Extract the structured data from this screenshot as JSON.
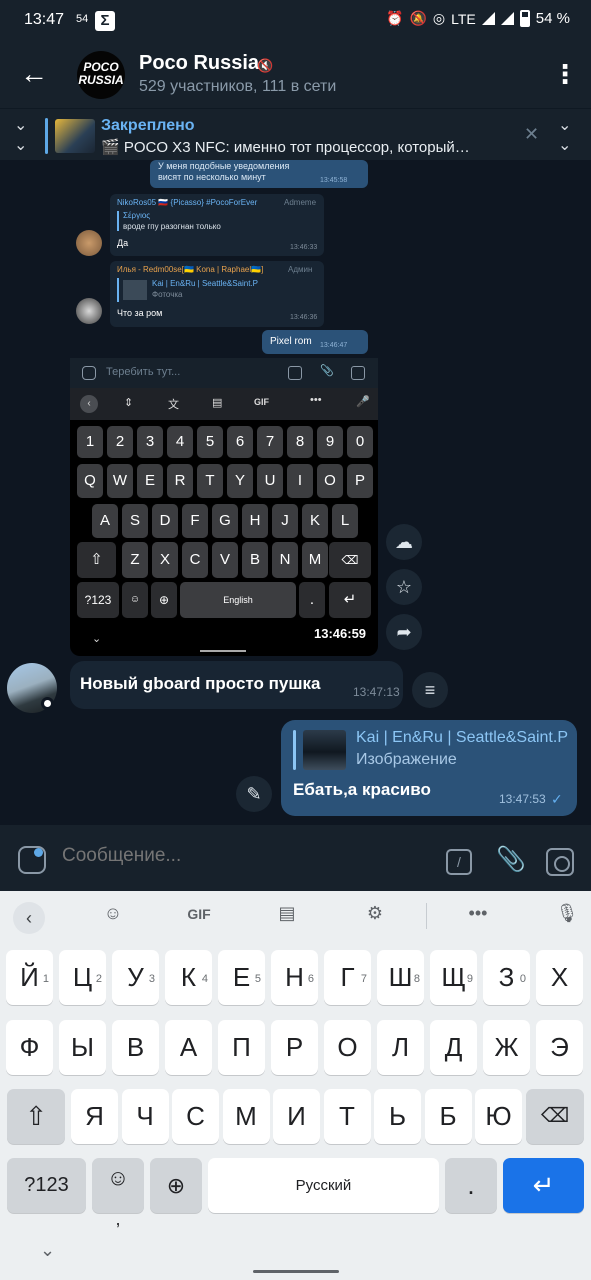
{
  "status": {
    "time": "13:47",
    "notif": "54",
    "network": "LTE",
    "battery": "54 %"
  },
  "header": {
    "avatar_lines": [
      "POCO",
      "RUSSIA"
    ],
    "title": "Poco Russia",
    "subtitle": "529 участников, 111 в сети"
  },
  "pinned": {
    "title": "Закреплено",
    "text": "🎬 POCO X3 NFC: именно тот процессор, который…"
  },
  "inner_screenshot": {
    "msg_top": {
      "text": "У меня подобные уведомления висят по несколько минут",
      "time": "13:45:58"
    },
    "msg_niko": {
      "sender": "NikoRos05 🇷🇺 {Picasso} #PocoForEver",
      "role": "Admeme",
      "reply_name": "Σέργιος",
      "reply_text": "вроде гпу разогнан только",
      "text": "Да",
      "time": "13:46:33"
    },
    "msg_ilya": {
      "sender": "Илья - Redm00se[🇺🇦 Kona | Raphael🇺🇦]",
      "role": "Админ",
      "reply_name": "Kai | En&Ru | Seattle&Saint.P",
      "reply_text": "Фоточка",
      "text": "Что за ром",
      "time": "13:46:36"
    },
    "msg_pixel": {
      "text": "Pixel rom",
      "time": "13:46:47"
    },
    "input_placeholder": "Теребить тут...",
    "kb_row1": [
      "1",
      "2",
      "3",
      "4",
      "5",
      "6",
      "7",
      "8",
      "9",
      "0"
    ],
    "kb_row2": [
      "Q",
      "W",
      "E",
      "R",
      "T",
      "Y",
      "U",
      "I",
      "O",
      "P"
    ],
    "kb_row3": [
      "A",
      "S",
      "D",
      "F",
      "G",
      "H",
      "J",
      "K",
      "L"
    ],
    "kb_row4": [
      "Z",
      "X",
      "C",
      "V",
      "B",
      "N",
      "M"
    ],
    "kb_sym": "?123",
    "kb_space": "English",
    "kb_clock": "13:46:59",
    "kb_gif": "GIF"
  },
  "messages": [
    {
      "text": "Новый gboard просто пушка",
      "time": "13:47:13"
    },
    {
      "reply_name": "Kai | En&Ru | Seattle&Saint.P",
      "reply_text": "Изображение",
      "text": "Ебать,а красиво",
      "time": "13:47:53"
    }
  ],
  "composer": {
    "placeholder": "Сообщение..."
  },
  "keyboard": {
    "gif": "GIF",
    "row1": [
      "Й",
      "Ц",
      "У",
      "К",
      "Е",
      "Н",
      "Г",
      "Ш",
      "Щ",
      "З",
      "Х"
    ],
    "row1_hints": [
      "1",
      "2",
      "3",
      "4",
      "5",
      "6",
      "7",
      "8",
      "9",
      "0",
      ""
    ],
    "row2": [
      "Ф",
      "Ы",
      "В",
      "А",
      "П",
      "Р",
      "О",
      "Л",
      "Д",
      "Ж",
      "Э"
    ],
    "row3": [
      "Я",
      "Ч",
      "С",
      "М",
      "И",
      "Т",
      "Ь",
      "Б",
      "Ю"
    ],
    "symbols": "?123",
    "comma": ",",
    "space": "Русский",
    "period": "."
  },
  "colors": {
    "accent": "#5ea8e6",
    "outgoing_bubble": "#2b5278",
    "incoming_bubble": "#182533",
    "enter_key": "#1a73e8"
  }
}
